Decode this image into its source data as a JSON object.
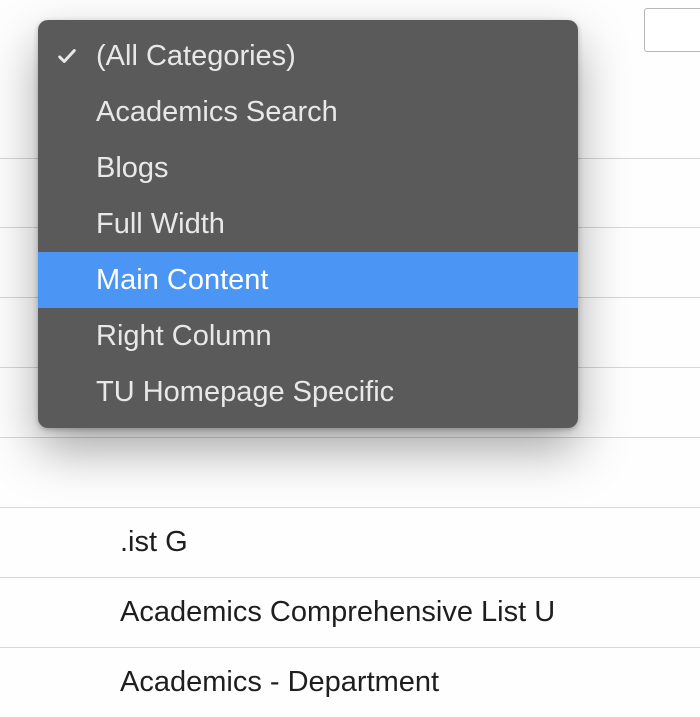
{
  "dropdown": {
    "items": [
      {
        "label": "(All Categories)",
        "selected": true,
        "highlighted": false
      },
      {
        "label": "Academics Search",
        "selected": false,
        "highlighted": false
      },
      {
        "label": "Blogs",
        "selected": false,
        "highlighted": false
      },
      {
        "label": "Full Width",
        "selected": false,
        "highlighted": false
      },
      {
        "label": "Main Content",
        "selected": false,
        "highlighted": true
      },
      {
        "label": "Right Column",
        "selected": false,
        "highlighted": false
      },
      {
        "label": "TU Homepage Specific",
        "selected": false,
        "highlighted": false
      }
    ]
  },
  "bgRows": {
    "r0": "",
    "r1": "",
    "r2": "",
    "r3": "",
    "r4": "",
    "r5": ".ist G",
    "r6": "Academics Comprehensive List U",
    "r7": "Academics - Department"
  }
}
